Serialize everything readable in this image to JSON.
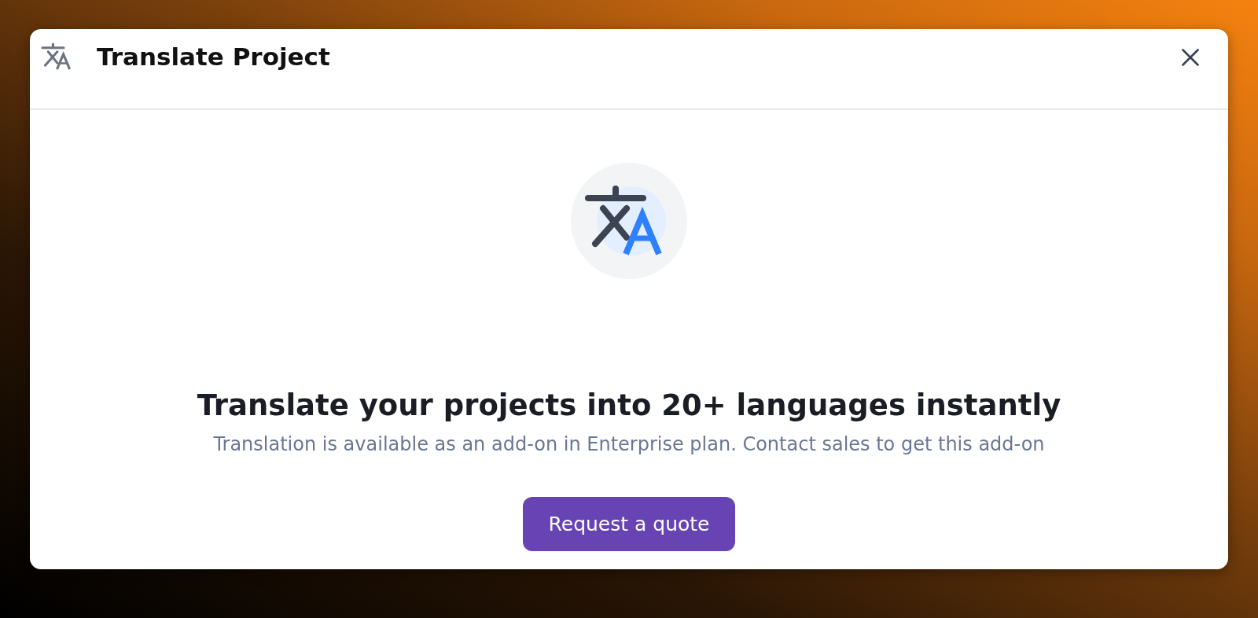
{
  "dialog": {
    "title": "Translate Project"
  },
  "promo": {
    "heading": "Translate your projects into 20+ languages instantly",
    "description": "Translation is available as an add-on in Enterprise plan. Contact sales to get this add-on"
  },
  "button": {
    "label": "Request a quote"
  }
}
